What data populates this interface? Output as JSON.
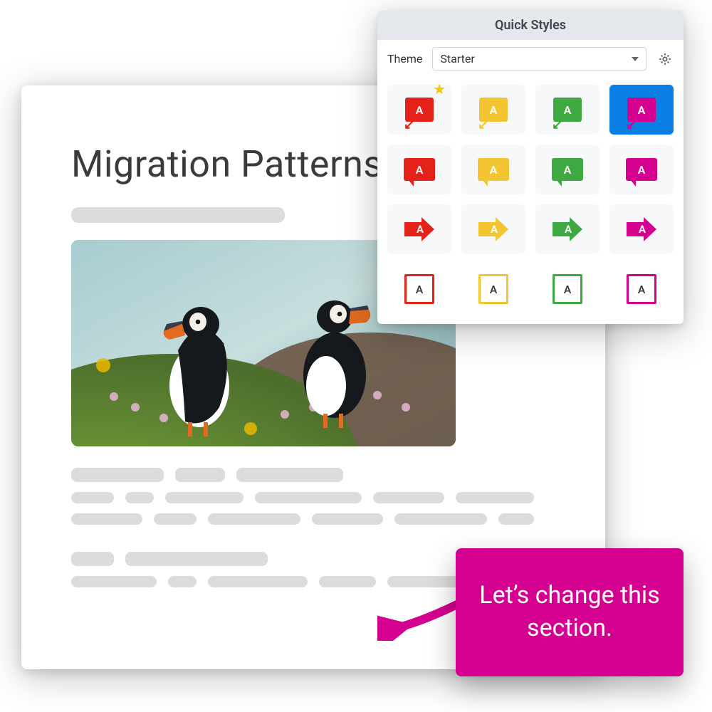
{
  "document": {
    "title": "Migration Patterns"
  },
  "popover": {
    "title": "Quick Styles",
    "theme_label": "Theme",
    "theme_value": "Starter"
  },
  "swatches": {
    "letter": "A",
    "colors": {
      "red": "#e5221a",
      "yellow": "#f3c533",
      "green": "#3da940",
      "magenta": "#d4008f",
      "selected_bg": "#0a7fe3"
    }
  },
  "callout": {
    "text": "Let’s change this section."
  }
}
